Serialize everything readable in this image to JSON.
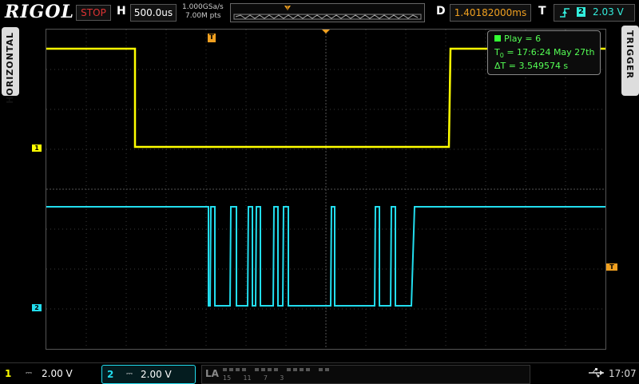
{
  "header": {
    "brand": "RIGOL",
    "run_state": "STOP",
    "h_label": "H",
    "timebase": "500.0us",
    "sample_rate": "1.000GSa/s",
    "memory_depth": "7.00M pts",
    "d_label": "D",
    "delay": "1.40182000ms",
    "t_label": "T",
    "trigger_source": "2",
    "trigger_level": "2.03 V"
  },
  "side_tabs": {
    "horizontal": "HORIZONTAL",
    "trigger": "TRIGGER"
  },
  "info_box": {
    "play": "Play = 6",
    "t0": "T",
    "t0_sub": "0",
    "t0_value": " = 17:6:24 May 27th",
    "delta": "ΔT = 3.549574 s"
  },
  "markers": {
    "ch1": "1",
    "ch2": "2",
    "trigger_level": "T",
    "trigger_pos": "T"
  },
  "footer": {
    "ch1_num": "1",
    "ch1_scale": "2.00 V",
    "ch2_num": "2",
    "ch2_scale": "2.00 V",
    "la_label": "LA",
    "la_digits": "15      11      7      3",
    "clock": "17:07"
  },
  "colors": {
    "ch1": "#ffff00",
    "ch2": "#22ddee",
    "trigger": "#f0a020",
    "info_text": "#55ff55"
  }
}
